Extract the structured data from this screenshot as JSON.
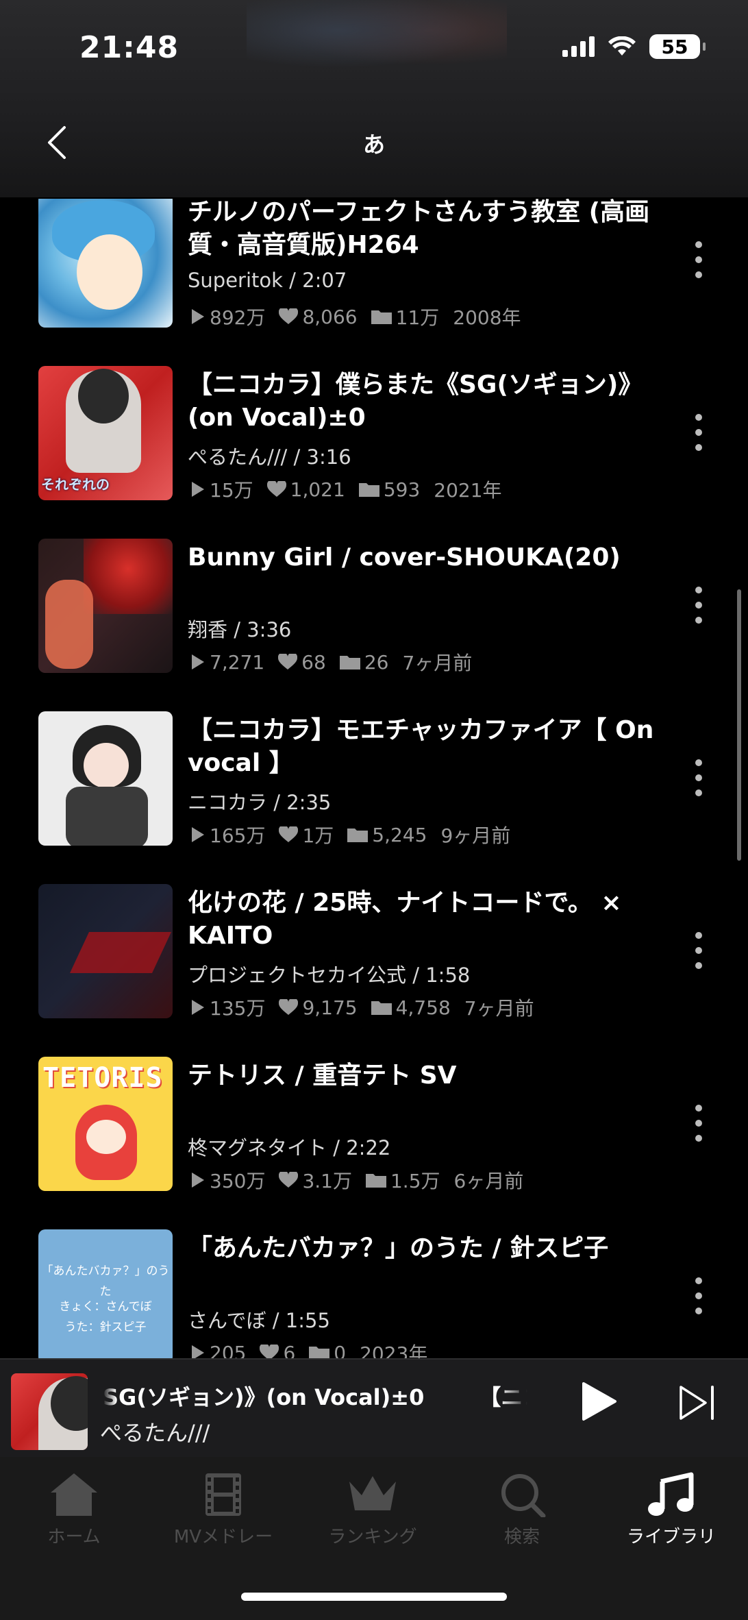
{
  "status_bar": {
    "time": "21:48",
    "battery": "55"
  },
  "header": {
    "title": "あ"
  },
  "videos": [
    {
      "title": "チルノのパーフェクトさんすう教室 (高画質・高音質版)H264",
      "uploader": "Superitok",
      "duration": "2:07",
      "views": "892万",
      "likes": "8,066",
      "mylists": "11万",
      "posted": "2008年"
    },
    {
      "title": "【ニコカラ】僕らまた《SG(ソギョン)》(on Vocal)±0",
      "uploader": "ぺるたん///",
      "duration": "3:16",
      "views": "15万",
      "likes": "1,021",
      "mylists": "593",
      "posted": "2021年"
    },
    {
      "title": "Bunny Girl / cover-SHOUKA(20)",
      "uploader": "翔香",
      "duration": "3:36",
      "views": "7,271",
      "likes": "68",
      "mylists": "26",
      "posted": "7ヶ月前"
    },
    {
      "title": "【ニコカラ】モエチャッカファイア【 On vocal 】",
      "uploader": "ニコカラ",
      "duration": "2:35",
      "views": "165万",
      "likes": "1万",
      "mylists": "5,245",
      "posted": "9ヶ月前"
    },
    {
      "title": "化けの花 / 25時、ナイトコードで。 × KAITO",
      "uploader": "プロジェクトセカイ公式",
      "duration": "1:58",
      "views": "135万",
      "likes": "9,175",
      "mylists": "4,758",
      "posted": "7ヶ月前"
    },
    {
      "title": "テトリス / 重音テト SV",
      "uploader": "柊マグネタイト",
      "duration": "2:22",
      "views": "350万",
      "likes": "3.1万",
      "mylists": "1.5万",
      "posted": "6ヶ月前"
    },
    {
      "title": "「あんたバカァ？」のうた / 針スピ子",
      "uploader": "さんでぼ",
      "duration": "1:55",
      "views": "205",
      "likes": "6",
      "mylists": "0",
      "posted": "2023年"
    }
  ],
  "thumbnails": {
    "item2_caption": "それぞれの",
    "item6_logo": "TETORIS",
    "item7_lines": [
      "「あんたバカァ？」のうた",
      "きょく：さんでぼ",
      "うた：針スピ子"
    ]
  },
  "mini_player": {
    "title": "SG(ソギョン)》(on Vocal)±0",
    "title_next": "【ニコ",
    "artist": "ぺるたん///"
  },
  "tabs": [
    {
      "label": "ホーム",
      "icon": "home-icon"
    },
    {
      "label": "MVメドレー",
      "icon": "film-icon"
    },
    {
      "label": "ランキング",
      "icon": "crown-icon"
    },
    {
      "label": "検索",
      "icon": "search-icon"
    },
    {
      "label": "ライブラリ",
      "icon": "music-note-icon"
    }
  ],
  "colors": {
    "background": "#000000",
    "secondary_text": "#9a9a9a",
    "tab_inactive": "#4e4e4e",
    "tab_active": "#ffffff"
  }
}
